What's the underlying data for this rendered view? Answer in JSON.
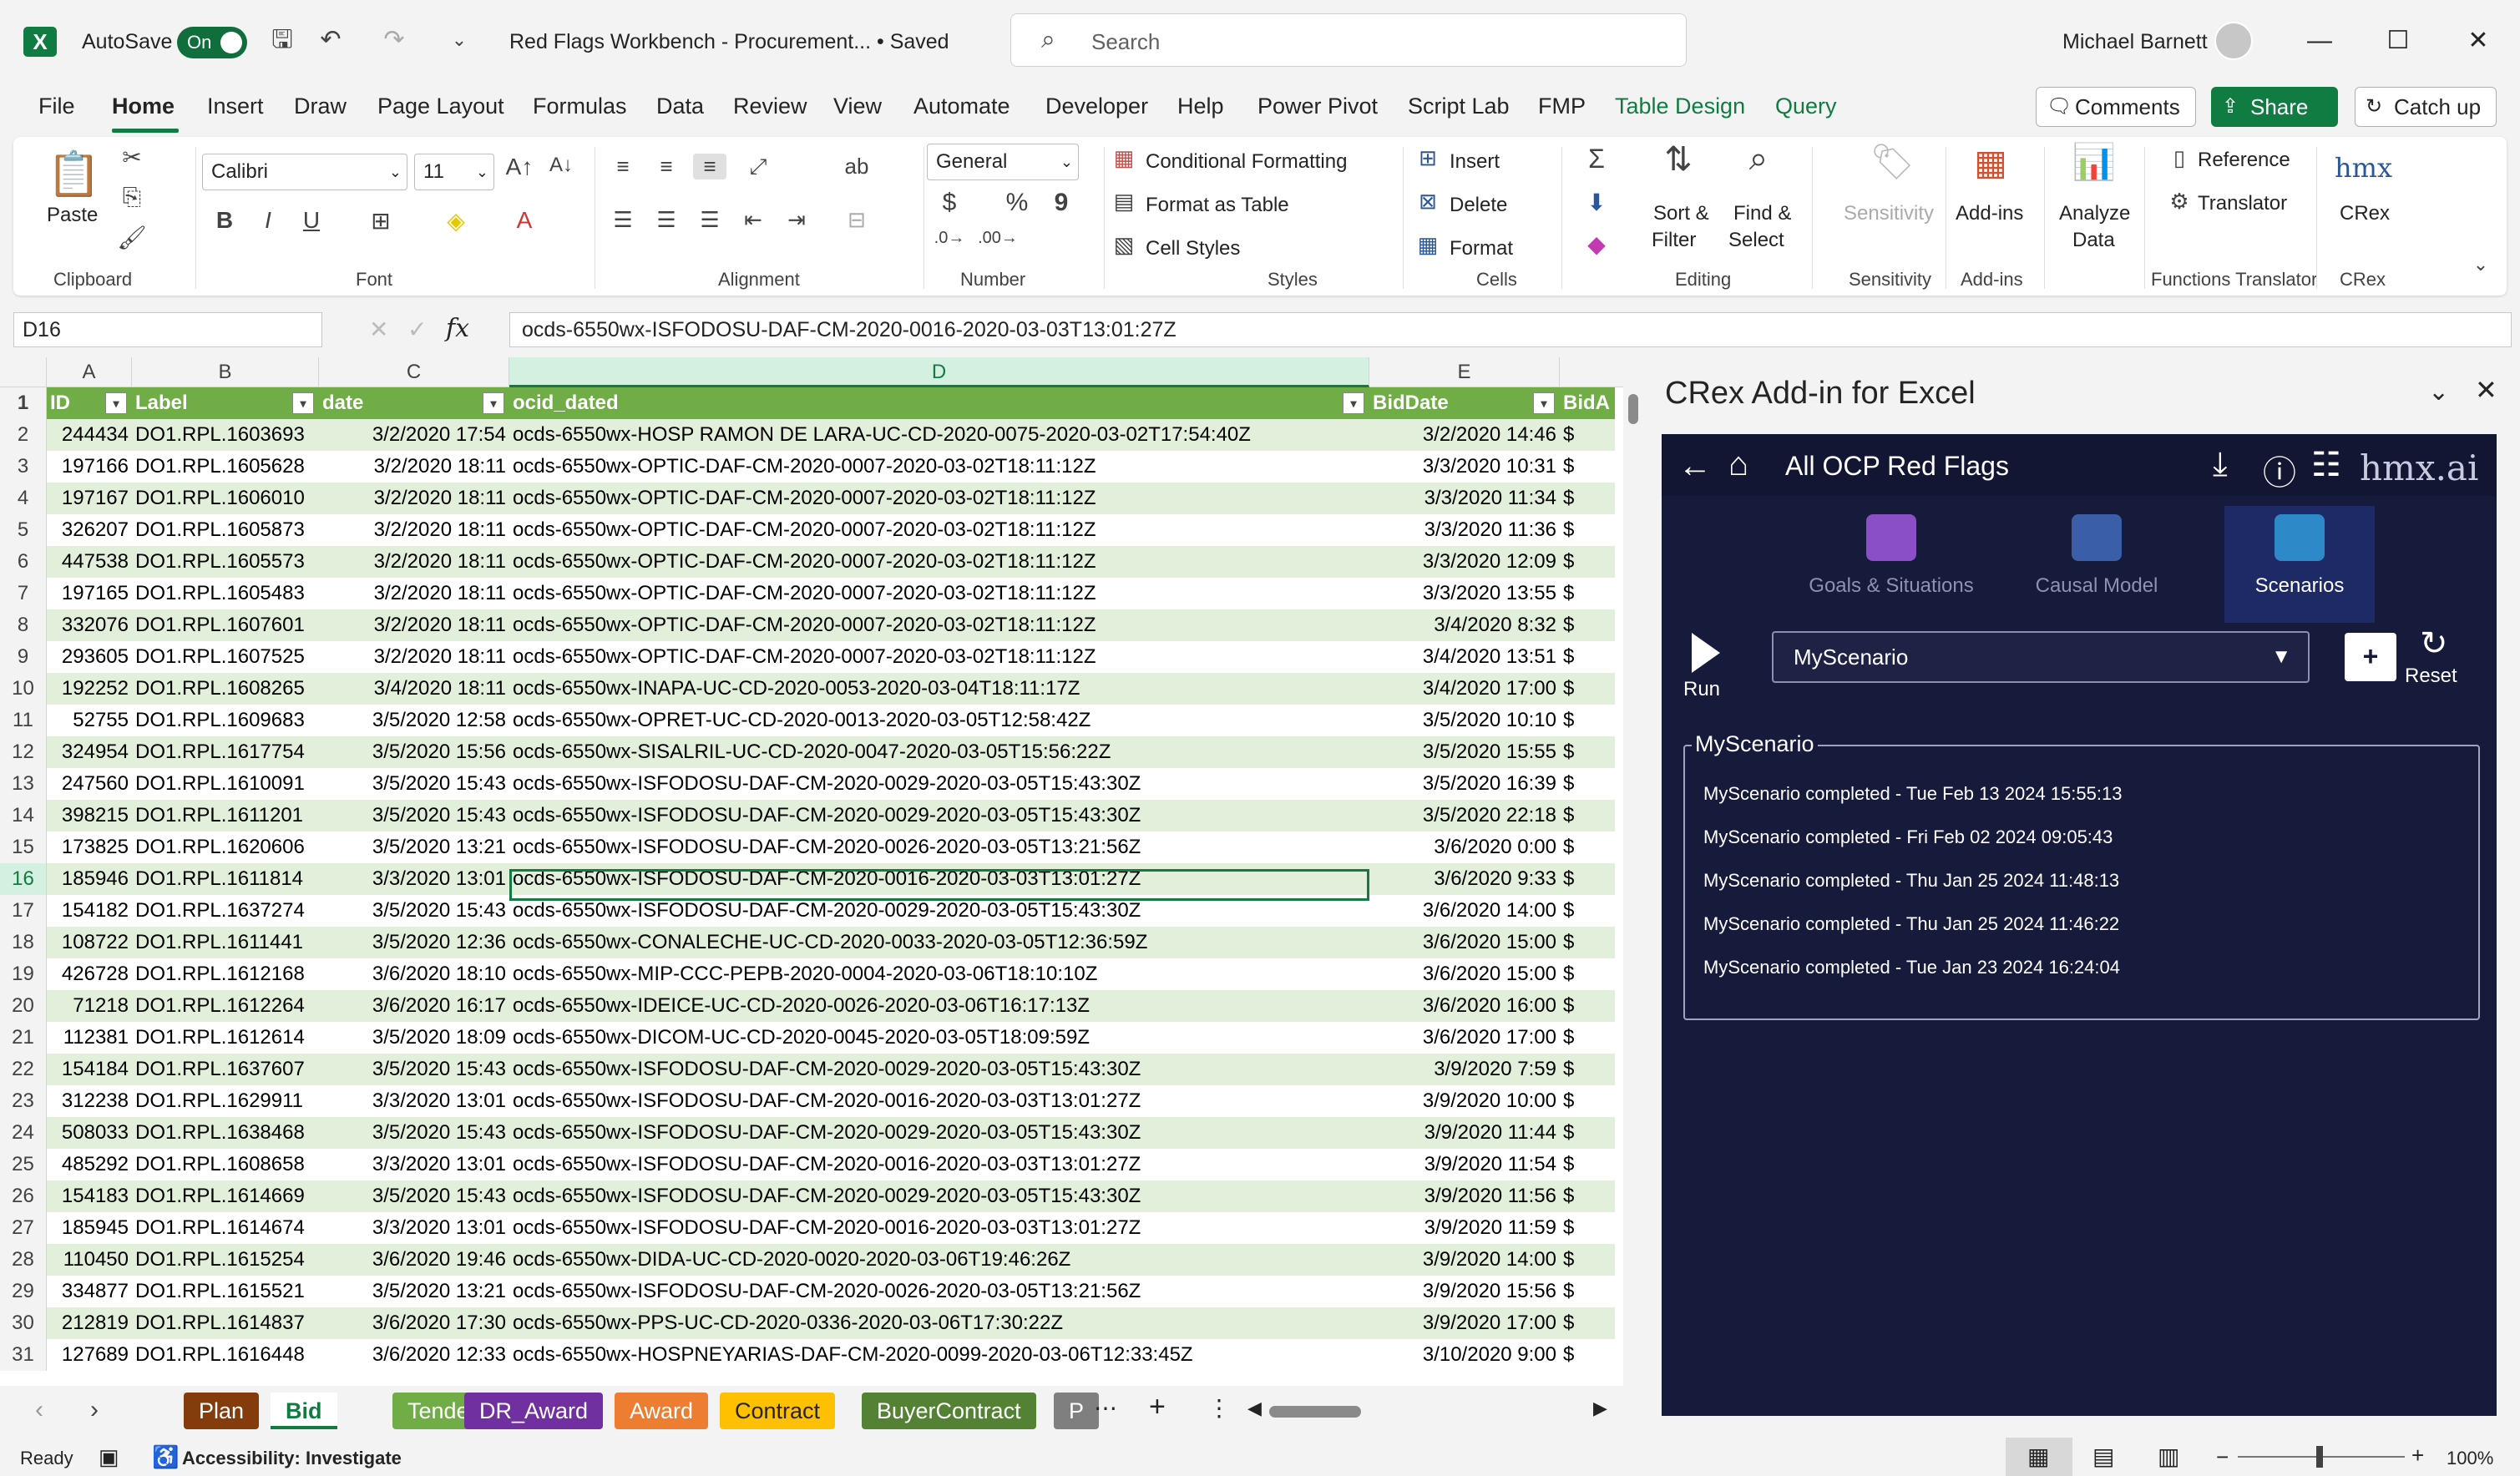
{
  "titlebar": {
    "autosave_label": "AutoSave",
    "autosave_state": "On",
    "doc_title": "Red Flags Workbench - Procurement... • Saved",
    "search_placeholder": "Search",
    "user_name": "Michael Barnett"
  },
  "menu": [
    "File",
    "Home",
    "Insert",
    "Draw",
    "Page Layout",
    "Formulas",
    "Data",
    "Review",
    "View",
    "Automate",
    "Developer",
    "Help",
    "Power Pivot",
    "Script Lab",
    "FMP",
    "Table Design",
    "Query"
  ],
  "menu_active": "Home",
  "actions": {
    "comments": "Comments",
    "share": "Share",
    "catchup": "Catch up"
  },
  "ribbon": {
    "clipboard": {
      "label": "Clipboard",
      "paste": "Paste"
    },
    "font": {
      "label": "Font",
      "family": "Calibri",
      "size": "11",
      "bold": "B",
      "italic": "I",
      "underline": "U"
    },
    "alignment": {
      "label": "Alignment"
    },
    "number": {
      "label": "Number",
      "format": "General",
      "currency": "$",
      "percent": "%",
      "comma": "9"
    },
    "styles": {
      "label": "Styles",
      "cond": "Conditional Formatting",
      "table": "Format as Table",
      "cell": "Cell Styles"
    },
    "cells": {
      "label": "Cells",
      "insert": "Insert",
      "delete": "Delete",
      "format": "Format"
    },
    "editing": {
      "label": "Editing",
      "sort1": "Sort &",
      "sort2": "Filter",
      "find1": "Find &",
      "find2": "Select"
    },
    "sensitivity": {
      "label": "Sensitivity",
      "btn": "Sensitivity"
    },
    "addins": {
      "label": "Add-ins",
      "btn": "Add-ins"
    },
    "analyze": {
      "btn1": "Analyze",
      "btn2": "Data"
    },
    "functions": {
      "label": "Functions Translator",
      "ref": "Reference",
      "trans": "Translator"
    },
    "crex": {
      "label": "CRex",
      "btn": "CRex",
      "logo": "hmx"
    }
  },
  "formula": {
    "namebox": "D16",
    "fx": "fx",
    "content": "ocds-6550wx-ISFODOSU-DAF-CM-2020-0016-2020-03-03T13:01:27Z"
  },
  "columns": [
    "A",
    "B",
    "C",
    "D",
    "E"
  ],
  "headers": [
    "ID",
    "Label",
    "date",
    "ocid_dated",
    "BidDate",
    "BidA"
  ],
  "rows": [
    [
      "244434",
      "DO1.RPL.1603693",
      "3/2/2020 17:54",
      "ocds-6550wx-HOSP RAMON DE LARA-UC-CD-2020-0075-2020-03-02T17:54:40Z",
      "3/2/2020 14:46",
      "$"
    ],
    [
      "197166",
      "DO1.RPL.1605628",
      "3/2/2020 18:11",
      "ocds-6550wx-OPTIC-DAF-CM-2020-0007-2020-03-02T18:11:12Z",
      "3/3/2020 10:31",
      "$"
    ],
    [
      "197167",
      "DO1.RPL.1606010",
      "3/2/2020 18:11",
      "ocds-6550wx-OPTIC-DAF-CM-2020-0007-2020-03-02T18:11:12Z",
      "3/3/2020 11:34",
      "$"
    ],
    [
      "326207",
      "DO1.RPL.1605873",
      "3/2/2020 18:11",
      "ocds-6550wx-OPTIC-DAF-CM-2020-0007-2020-03-02T18:11:12Z",
      "3/3/2020 11:36",
      "$"
    ],
    [
      "447538",
      "DO1.RPL.1605573",
      "3/2/2020 18:11",
      "ocds-6550wx-OPTIC-DAF-CM-2020-0007-2020-03-02T18:11:12Z",
      "3/3/2020 12:09",
      "$"
    ],
    [
      "197165",
      "DO1.RPL.1605483",
      "3/2/2020 18:11",
      "ocds-6550wx-OPTIC-DAF-CM-2020-0007-2020-03-02T18:11:12Z",
      "3/3/2020 13:55",
      "$"
    ],
    [
      "332076",
      "DO1.RPL.1607601",
      "3/2/2020 18:11",
      "ocds-6550wx-OPTIC-DAF-CM-2020-0007-2020-03-02T18:11:12Z",
      "3/4/2020 8:32",
      "$"
    ],
    [
      "293605",
      "DO1.RPL.1607525",
      "3/2/2020 18:11",
      "ocds-6550wx-OPTIC-DAF-CM-2020-0007-2020-03-02T18:11:12Z",
      "3/4/2020 13:51",
      "$"
    ],
    [
      "192252",
      "DO1.RPL.1608265",
      "3/4/2020 18:11",
      "ocds-6550wx-INAPA-UC-CD-2020-0053-2020-03-04T18:11:17Z",
      "3/4/2020 17:00",
      "$"
    ],
    [
      "52755",
      "DO1.RPL.1609683",
      "3/5/2020 12:58",
      "ocds-6550wx-OPRET-UC-CD-2020-0013-2020-03-05T12:58:42Z",
      "3/5/2020 10:10",
      "$"
    ],
    [
      "324954",
      "DO1.RPL.1617754",
      "3/5/2020 15:56",
      "ocds-6550wx-SISALRIL-UC-CD-2020-0047-2020-03-05T15:56:22Z",
      "3/5/2020 15:55",
      "$"
    ],
    [
      "247560",
      "DO1.RPL.1610091",
      "3/5/2020 15:43",
      "ocds-6550wx-ISFODOSU-DAF-CM-2020-0029-2020-03-05T15:43:30Z",
      "3/5/2020 16:39",
      "$"
    ],
    [
      "398215",
      "DO1.RPL.1611201",
      "3/5/2020 15:43",
      "ocds-6550wx-ISFODOSU-DAF-CM-2020-0029-2020-03-05T15:43:30Z",
      "3/5/2020 22:18",
      "$"
    ],
    [
      "173825",
      "DO1.RPL.1620606",
      "3/5/2020 13:21",
      "ocds-6550wx-ISFODOSU-DAF-CM-2020-0026-2020-03-05T13:21:56Z",
      "3/6/2020 0:00",
      "$"
    ],
    [
      "185946",
      "DO1.RPL.1611814",
      "3/3/2020 13:01",
      "ocds-6550wx-ISFODOSU-DAF-CM-2020-0016-2020-03-03T13:01:27Z",
      "3/6/2020 9:33",
      "$"
    ],
    [
      "154182",
      "DO1.RPL.1637274",
      "3/5/2020 15:43",
      "ocds-6550wx-ISFODOSU-DAF-CM-2020-0029-2020-03-05T15:43:30Z",
      "3/6/2020 14:00",
      "$"
    ],
    [
      "108722",
      "DO1.RPL.1611441",
      "3/5/2020 12:36",
      "ocds-6550wx-CONALECHE-UC-CD-2020-0033-2020-03-05T12:36:59Z",
      "3/6/2020 15:00",
      "$"
    ],
    [
      "426728",
      "DO1.RPL.1612168",
      "3/6/2020 18:10",
      "ocds-6550wx-MIP-CCC-PEPB-2020-0004-2020-03-06T18:10:10Z",
      "3/6/2020 15:00",
      "$"
    ],
    [
      "71218",
      "DO1.RPL.1612264",
      "3/6/2020 16:17",
      "ocds-6550wx-IDEICE-UC-CD-2020-0026-2020-03-06T16:17:13Z",
      "3/6/2020 16:00",
      "$"
    ],
    [
      "112381",
      "DO1.RPL.1612614",
      "3/5/2020 18:09",
      "ocds-6550wx-DICOM-UC-CD-2020-0045-2020-03-05T18:09:59Z",
      "3/6/2020 17:00",
      "$"
    ],
    [
      "154184",
      "DO1.RPL.1637607",
      "3/5/2020 15:43",
      "ocds-6550wx-ISFODOSU-DAF-CM-2020-0029-2020-03-05T15:43:30Z",
      "3/9/2020 7:59",
      "$"
    ],
    [
      "312238",
      "DO1.RPL.1629911",
      "3/3/2020 13:01",
      "ocds-6550wx-ISFODOSU-DAF-CM-2020-0016-2020-03-03T13:01:27Z",
      "3/9/2020 10:00",
      "$"
    ],
    [
      "508033",
      "DO1.RPL.1638468",
      "3/5/2020 15:43",
      "ocds-6550wx-ISFODOSU-DAF-CM-2020-0029-2020-03-05T15:43:30Z",
      "3/9/2020 11:44",
      "$"
    ],
    [
      "485292",
      "DO1.RPL.1608658",
      "3/3/2020 13:01",
      "ocds-6550wx-ISFODOSU-DAF-CM-2020-0016-2020-03-03T13:01:27Z",
      "3/9/2020 11:54",
      "$"
    ],
    [
      "154183",
      "DO1.RPL.1614669",
      "3/5/2020 15:43",
      "ocds-6550wx-ISFODOSU-DAF-CM-2020-0029-2020-03-05T15:43:30Z",
      "3/9/2020 11:56",
      "$"
    ],
    [
      "185945",
      "DO1.RPL.1614674",
      "3/3/2020 13:01",
      "ocds-6550wx-ISFODOSU-DAF-CM-2020-0016-2020-03-03T13:01:27Z",
      "3/9/2020 11:59",
      "$"
    ],
    [
      "110450",
      "DO1.RPL.1615254",
      "3/6/2020 19:46",
      "ocds-6550wx-DIDA-UC-CD-2020-0020-2020-03-06T19:46:26Z",
      "3/9/2020 14:00",
      "$"
    ],
    [
      "334877",
      "DO1.RPL.1615521",
      "3/5/2020 13:21",
      "ocds-6550wx-ISFODOSU-DAF-CM-2020-0026-2020-03-05T13:21:56Z",
      "3/9/2020 15:56",
      "$"
    ],
    [
      "212819",
      "DO1.RPL.1614837",
      "3/6/2020 17:30",
      "ocds-6550wx-PPS-UC-CD-2020-0336-2020-03-06T17:30:22Z",
      "3/9/2020 17:00",
      "$"
    ],
    [
      "127689",
      "DO1.RPL.1616448",
      "3/6/2020 12:33",
      "ocds-6550wx-HOSPNEYARIAS-DAF-CM-2020-0099-2020-03-06T12:33:45Z",
      "3/10/2020 9:00",
      "$"
    ]
  ],
  "tabs": [
    {
      "name": "Plan",
      "color": "#843c0c"
    },
    {
      "name": "Bid",
      "color": "#ffffff"
    },
    {
      "name": "Tender",
      "color": "#70ad47"
    },
    {
      "name": "DR_Award",
      "color": "#7030a0"
    },
    {
      "name": "Award",
      "color": "#ed7d31"
    },
    {
      "name": "Contract",
      "color": "#ffc000"
    },
    {
      "name": "BuyerContract",
      "color": "#548235"
    },
    {
      "name": "P",
      "color": "#7f7f7f"
    }
  ],
  "status": {
    "ready": "Ready",
    "accessibility": "Accessibility: Investigate",
    "zoom": "100%"
  },
  "pane": {
    "title": "CRex Add-in for Excel",
    "header": "All OCP Red Flags",
    "brand": "hmx.ai",
    "navtabs": [
      {
        "label": "Goals & Situations",
        "color": "#8a4fc7"
      },
      {
        "label": "Causal Model",
        "color": "#3a5fa8"
      },
      {
        "label": "Scenarios",
        "color": "#2e89c9"
      }
    ],
    "run": "Run",
    "reset": "Reset",
    "scenario": "MyScenario",
    "add": "+",
    "fieldset": "MyScenario",
    "log": [
      "MyScenario completed - Tue Feb 13 2024 15:55:13",
      "MyScenario completed - Fri Feb 02 2024 09:05:43",
      "MyScenario completed - Thu Jan 25 2024 11:48:13",
      "MyScenario completed - Thu Jan 25 2024 11:46:22",
      "MyScenario completed - Tue Jan 23 2024 16:24:04"
    ]
  }
}
